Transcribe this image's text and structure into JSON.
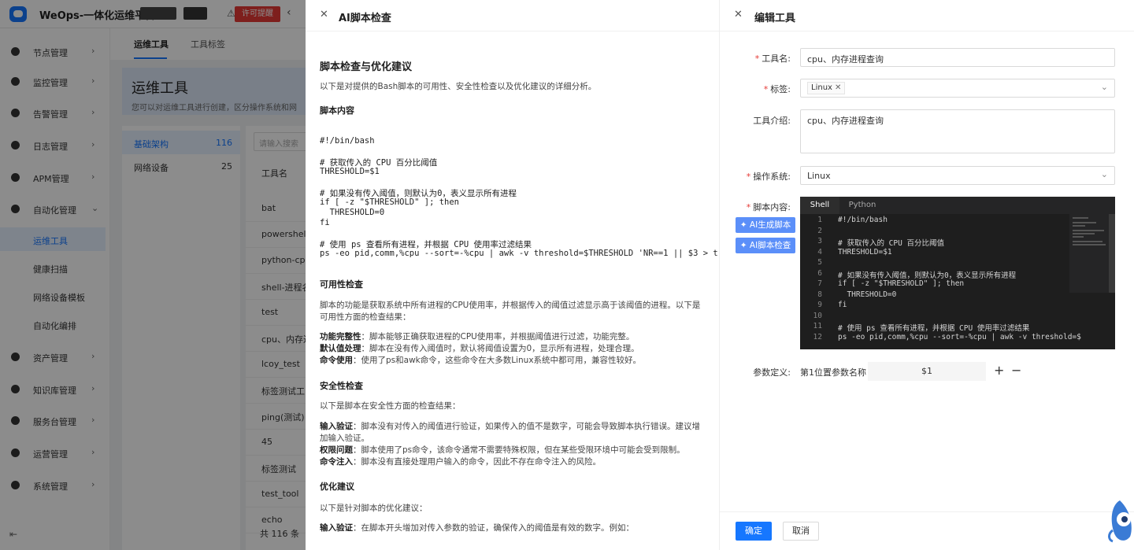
{
  "app": {
    "title": "WeOps-一体化运维平台",
    "license_label": "许可提醒"
  },
  "sidebar": {
    "items": [
      {
        "label": "节点管理"
      },
      {
        "label": "监控管理"
      },
      {
        "label": "告警管理"
      },
      {
        "label": "日志管理"
      },
      {
        "label": "APM管理"
      },
      {
        "label": "自动化管理"
      },
      {
        "label": "资产管理"
      },
      {
        "label": "知识库管理"
      },
      {
        "label": "服务台管理"
      },
      {
        "label": "运营管理"
      },
      {
        "label": "系统管理"
      }
    ],
    "subitems": [
      {
        "label": "运维工具"
      },
      {
        "label": "健康扫描"
      },
      {
        "label": "网络设备模板"
      },
      {
        "label": "自动化编排"
      }
    ]
  },
  "main": {
    "tabs": [
      {
        "label": "运维工具"
      },
      {
        "label": "工具标签"
      }
    ],
    "banner_title": "运维工具",
    "banner_desc": "您可以对运维工具进行创建，区分操作系统和网",
    "categories": [
      {
        "label": "基础架构",
        "count": "116"
      },
      {
        "label": "网络设备",
        "count": "25"
      }
    ],
    "search_placeholder": "请输入搜索",
    "column_header": "工具名",
    "tools": [
      "bat",
      "powershell-",
      "python-cpu",
      "shell-进程名",
      "test",
      "cpu、内存进",
      "lcoy_test",
      "标签测试工",
      "ping(测试)",
      "45",
      "标签测试",
      "test_tool",
      "echo"
    ],
    "total": "共 116 条"
  },
  "ai_drawer": {
    "title": "AI脚本检查",
    "heading": "脚本检查与优化建议",
    "intro": "以下是对提供的Bash脚本的可用性、安全性检查以及优化建议的详细分析。",
    "script_heading": "脚本内容",
    "script_lines": [
      "#!/bin/bash",
      "",
      "# 获取传入的 CPU 百分比阈值",
      "THRESHOLD=$1",
      "",
      "# 如果没有传入阈值，则默认为0，表义显示所有进程",
      "if [ -z \"$THRESHOLD\" ]; then",
      "  THRESHOLD=0",
      "fi",
      "",
      "# 使用 ps 查看所有进程，并根据 CPU 使用率过滤结果",
      "ps -eo pid,comm,%cpu --sort=-%cpu | awk -v threshold=$THRESHOLD 'NR==1 || $3 > t"
    ],
    "usability_heading": "可用性检查",
    "usability_intro": "脚本的功能是获取系统中所有进程的CPU使用率，并根据传入的阈值过滤显示高于该阈值的进程。以下是可用性方面的检查结果：",
    "usability_items": [
      {
        "key": "功能完整性",
        "text": "：脚本能够正确获取进程的CPU使用率，并根据阈值进行过滤，功能完整。"
      },
      {
        "key": "默认值处理",
        "text": "：脚本在没有传入阈值时，默认将阈值设置为0，显示所有进程，处理合理。"
      },
      {
        "key": "命令使用",
        "text": "：使用了ps和awk命令，这些命令在大多数Linux系统中都可用，兼容性较好。"
      }
    ],
    "security_heading": "安全性检查",
    "security_intro": "以下是脚本在安全性方面的检查结果：",
    "security_items": [
      {
        "key": "输入验证",
        "text": "：脚本没有对传入的阈值进行验证，如果传入的值不是数字，可能会导致脚本执行错误。建议增加输入验证。"
      },
      {
        "key": "权限问题",
        "text": "：脚本使用了ps命令，该命令通常不需要特殊权限，但在某些受限环境中可能会受到限制。"
      },
      {
        "key": "命令注入",
        "text": "：脚本没有直接处理用户输入的命令，因此不存在命令注入的风险。"
      }
    ],
    "optimize_heading": "优化建议",
    "optimize_intro": "以下是针对脚本的优化建议：",
    "optimize_items": [
      {
        "key": "输入验证",
        "text": "：在脚本开头增加对传入参数的验证，确保传入的阈值是有效的数字。例如："
      }
    ]
  },
  "edit_drawer": {
    "title": "编辑工具",
    "name_label": "工具名:",
    "name_value": "cpu、内存进程查询",
    "tag_label": "标签:",
    "tag_value": "Linux",
    "intro_label": "工具介绍:",
    "intro_value": "cpu、内存进程查询",
    "os_label": "操作系统:",
    "os_value": "Linux",
    "script_label": "脚本内容:",
    "editor_tabs": [
      "Shell",
      "Python"
    ],
    "ai_generate": "AI生成脚本",
    "ai_check": "AI脚本检查",
    "code_lines": [
      "#!/bin/bash",
      "",
      "# 获取传入的 CPU 百分比阈值",
      "THRESHOLD=$1",
      "",
      "# 如果没有传入阈值，则默认为0，表义显示所有进程",
      "if [ -z \"$THRESHOLD\" ]; then",
      "  THRESHOLD=0",
      "fi",
      "",
      "# 使用 ps 查看所有进程，并根据 CPU 使用率过滤结果",
      "ps -eo pid,comm,%cpu --sort=-%cpu | awk -v threshold=$"
    ],
    "line_numbers": [
      "1",
      "2",
      "3",
      "4",
      "5",
      "6",
      "7",
      "8",
      "9",
      "10",
      "11",
      "12"
    ],
    "param_label": "参数定义:",
    "param_name": "第1位置参数名称",
    "param_value": "$1",
    "ok": "确定",
    "cancel": "取消"
  }
}
